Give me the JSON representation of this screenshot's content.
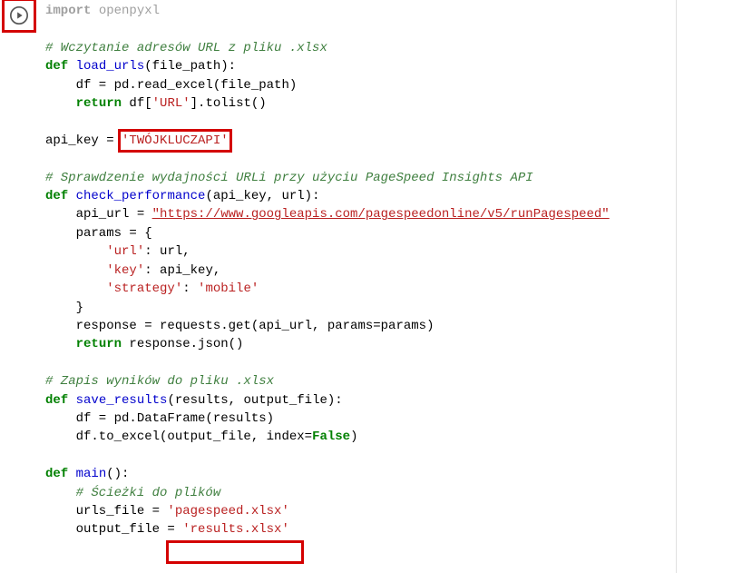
{
  "gutter": {
    "run_aria": "Run cell"
  },
  "highlights": [
    {
      "name": "highlight-api-key",
      "target": "api_key literal 'TWÓJKLUCZAPI'"
    },
    {
      "name": "highlight-urls-file",
      "target": "urls_file literal 'pagespeed.xlsx'"
    }
  ],
  "code": {
    "l1": {
      "import": "import",
      "mod": "openpyxl"
    },
    "l3": {
      "comment": "# Wczytanie adresów URL z pliku .xlsx"
    },
    "l4": {
      "def": "def",
      "name": "load_urls",
      "params": "(file_path):"
    },
    "l5": "    df = pd.read_excel(file_path)",
    "l6": {
      "ret": "return",
      "rest": " df[",
      "str": "'URL'",
      "tail": "].tolist()"
    },
    "l8a": "api_key = ",
    "l8b": "'TWÓJKLUCZAPI'",
    "l10": {
      "comment": "# Sprawdzenie wydajności URLi przy użyciu PageSpeed Insights API"
    },
    "l11": {
      "def": "def",
      "name": "check_performance",
      "params": "(api_key, url):"
    },
    "l12a": "    api_url = ",
    "l12b": "\"https://www.googleapis.com/pagespeedonline/v5/runPagespeed\"",
    "l13": "    params = {",
    "l14a": "        ",
    "l14b": "'url'",
    "l14c": ": url,",
    "l15a": "        ",
    "l15b": "'key'",
    "l15c": ": api_key,",
    "l16a": "        ",
    "l16b": "'strategy'",
    "l16c": ": ",
    "l16d": "'mobile'",
    "l17": "    }",
    "l18": "    response = requests.get(api_url, params=params)",
    "l19": {
      "ret": "return",
      "rest": " response.json()"
    },
    "l21": {
      "comment": "# Zapis wyników do pliku .xlsx"
    },
    "l22": {
      "def": "def",
      "name": "save_results",
      "params": "(results, output_file):"
    },
    "l23": "    df = pd.DataFrame(results)",
    "l24a": "    df.to_excel(output_file, index=",
    "l24b": "False",
    "l24c": ")",
    "l26": {
      "def": "def",
      "name": "main",
      "params": "():"
    },
    "l27": {
      "comment": "    # Ścieżki do plików"
    },
    "l28a": "    urls_file = ",
    "l28b": "'pagespeed.xlsx'",
    "l29a": "    output_file = ",
    "l29b": "'results.xlsx'"
  }
}
